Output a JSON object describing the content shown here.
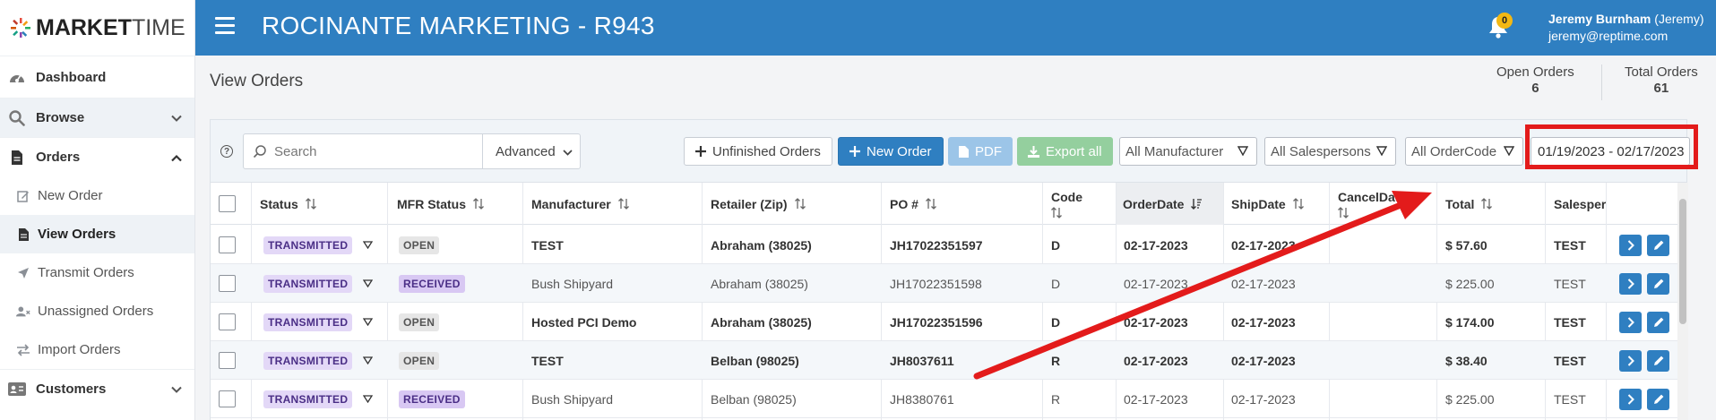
{
  "brand": {
    "logo_bold": "MARKET",
    "logo_light": "TIME"
  },
  "header": {
    "title": "ROCINANTE MARKETING - R943",
    "notifications_count": "0",
    "user_name": "Jeremy Burnham",
    "user_alias": "(Jeremy)",
    "user_email": "jeremy@reptime.com"
  },
  "sidebar": {
    "dashboard": "Dashboard",
    "browse": "Browse",
    "orders": "Orders",
    "sub": {
      "new_order": "New Order",
      "view_orders": "View Orders",
      "transmit_orders": "Transmit Orders",
      "unassigned_orders": "Unassigned Orders",
      "import_orders": "Import Orders"
    },
    "customers": "Customers"
  },
  "page": {
    "title": "View Orders",
    "open_orders_label": "Open Orders",
    "open_orders_value": "6",
    "total_orders_label": "Total Orders",
    "total_orders_value": "61"
  },
  "toolbar": {
    "help": "?",
    "search_placeholder": "Search",
    "advanced": "Advanced",
    "unfinished_orders": "Unfinished Orders",
    "new_order": "New Order",
    "pdf": "PDF",
    "export_all": "Export all",
    "manufacturer_filter": "All Manufacturer",
    "salesperson_filter": "All Salespersons",
    "ordercode_filter": "All OrderCode",
    "date_range": "01/19/2023 - 02/17/2023"
  },
  "table": {
    "headers": {
      "status": "Status",
      "mfr_status": "MFR Status",
      "manufacturer": "Manufacturer",
      "retailer": "Retailer (Zip)",
      "po": "PO #",
      "code": "Code",
      "order_date": "OrderDate",
      "ship_date": "ShipDate",
      "cancel_date": "CancelDate",
      "total": "Total",
      "salesperson": "Salesper"
    },
    "rows": [
      {
        "status": "TRANSMITTED",
        "mfr_status": "OPEN",
        "manufacturer": "TEST",
        "retailer": "Abraham (38025)",
        "po": "JH17022351597",
        "code": "D",
        "order_date": "02-17-2023",
        "ship_date": "02-17-2023",
        "cancel_date": "",
        "total": "$ 57.60",
        "salesperson": "TEST"
      },
      {
        "status": "TRANSMITTED",
        "mfr_status": "RECEIVED",
        "manufacturer": "Bush Shipyard",
        "retailer": "Abraham (38025)",
        "po": "JH17022351598",
        "code": "D",
        "order_date": "02-17-2023",
        "ship_date": "02-17-2023",
        "cancel_date": "",
        "total": "$ 225.00",
        "salesperson": "TEST"
      },
      {
        "status": "TRANSMITTED",
        "mfr_status": "OPEN",
        "manufacturer": "Hosted PCI Demo",
        "retailer": "Abraham (38025)",
        "po": "JH17022351596",
        "code": "D",
        "order_date": "02-17-2023",
        "ship_date": "02-17-2023",
        "cancel_date": "",
        "total": "$ 174.00",
        "salesperson": "TEST"
      },
      {
        "status": "TRANSMITTED",
        "mfr_status": "OPEN",
        "manufacturer": "TEST",
        "retailer": "Belban (98025)",
        "po": "JH8037611",
        "code": "R",
        "order_date": "02-17-2023",
        "ship_date": "02-17-2023",
        "cancel_date": "",
        "total": "$ 38.40",
        "salesperson": "TEST"
      },
      {
        "status": "TRANSMITTED",
        "mfr_status": "RECEIVED",
        "manufacturer": "Bush Shipyard",
        "retailer": "Belban (98025)",
        "po": "JH8380761",
        "code": "R",
        "order_date": "02-17-2023",
        "ship_date": "02-17-2023",
        "cancel_date": "",
        "total": "$ 225.00",
        "salesperson": "TEST"
      }
    ]
  },
  "colors": {
    "header_blue": "#2f7fc1",
    "annotation_red": "#e31b1b",
    "status_badge": "#e3d8f7",
    "export_green": "#94cf9e"
  }
}
